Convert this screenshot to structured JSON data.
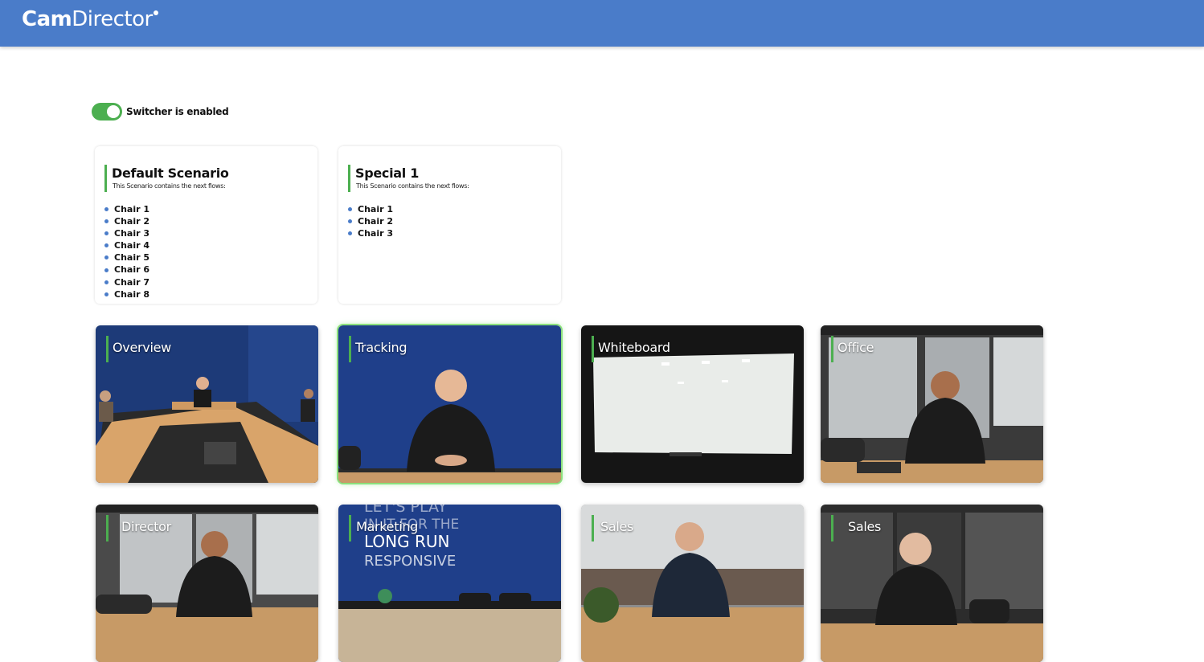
{
  "header": {
    "logo_strong": "Cam",
    "logo_light": "Director",
    "bg_color": "#4a7cc9"
  },
  "switcher": {
    "enabled": true,
    "label": "Switcher is enabled",
    "on_color": "#4caf50"
  },
  "scenarios": [
    {
      "title": "Default Scenario",
      "description": "This Scenario contains the next flows:",
      "flows": [
        "Chair 1",
        "Chair 2",
        "Chair 3",
        "Chair 4",
        "Chair 5",
        "Chair 6",
        "Chair 7",
        "Chair 8"
      ]
    },
    {
      "title": "Special 1",
      "description": "This Scenario contains the next flows:",
      "flows": [
        "Chair 1",
        "Chair 2",
        "Chair 3"
      ]
    }
  ],
  "cameras": [
    {
      "label": "Overview",
      "active": false
    },
    {
      "label": "Tracking",
      "active": true
    },
    {
      "label": "Whiteboard",
      "active": false
    },
    {
      "label": "Office",
      "active": false
    },
    {
      "label": "Director",
      "active": false
    },
    {
      "label": "Marketing",
      "active": false,
      "wall_text": [
        "LET'S PLAY",
        "IN IT FOR THE",
        "LONG RUN",
        "RESPONSIVE"
      ]
    },
    {
      "label": "Sales",
      "active": false
    },
    {
      "label": "Sales",
      "active": false
    }
  ]
}
